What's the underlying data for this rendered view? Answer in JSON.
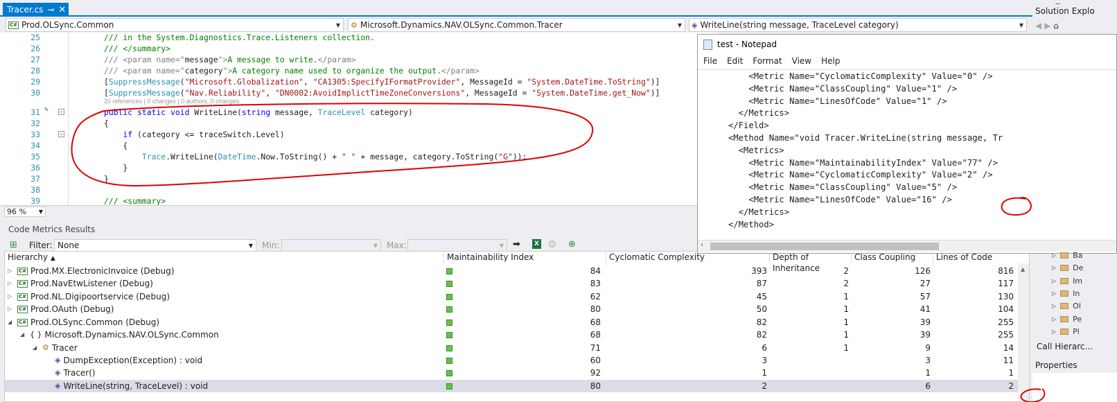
{
  "tab": {
    "title": "Tracer.cs",
    "pin": "⊸",
    "close": "✕"
  },
  "navbar": {
    "project": "Prod.OLSync.Common",
    "type": "Microsoft.Dynamics.NAV.OLSync.Common.Tracer",
    "member": "WriteLine(string message, TraceLevel category)"
  },
  "editor": {
    "lines": [
      {
        "n": "25",
        "segs": [
          {
            "t": "/// in the System.Diagnostics.Trace.Listeners collection.",
            "c": "cm"
          }
        ]
      },
      {
        "n": "26",
        "segs": [
          {
            "t": "/// </summary>",
            "c": "cm"
          }
        ]
      },
      {
        "n": "27",
        "segs": [
          {
            "t": "/// <param name=\"",
            "c": "xg"
          },
          {
            "t": "message",
            "c": ""
          },
          {
            "t": "\">",
            "c": "xg"
          },
          {
            "t": "A message to write.",
            "c": "cm"
          },
          {
            "t": "</param>",
            "c": "xg"
          }
        ]
      },
      {
        "n": "28",
        "segs": [
          {
            "t": "/// <param name=\"",
            "c": "xg"
          },
          {
            "t": "category",
            "c": ""
          },
          {
            "t": "\">",
            "c": "xg"
          },
          {
            "t": "A category name used to organize the output.",
            "c": "cm"
          },
          {
            "t": "</param>",
            "c": "xg"
          }
        ]
      },
      {
        "n": "29",
        "segs": [
          {
            "t": "[",
            "c": ""
          },
          {
            "t": "SuppressMessage",
            "c": "ty"
          },
          {
            "t": "(",
            "c": ""
          },
          {
            "t": "\"Microsoft.Globalization\"",
            "c": "st"
          },
          {
            "t": ", ",
            "c": ""
          },
          {
            "t": "\"CA1305:SpecifyIFormatProvider\"",
            "c": "st"
          },
          {
            "t": ", MessageId = ",
            "c": ""
          },
          {
            "t": "\"System.DateTime.ToString\"",
            "c": "st"
          },
          {
            "t": ")]",
            "c": ""
          }
        ]
      },
      {
        "n": "30",
        "segs": [
          {
            "t": "[",
            "c": ""
          },
          {
            "t": "SuppressMessage",
            "c": "ty"
          },
          {
            "t": "(",
            "c": ""
          },
          {
            "t": "\"Nav.Reliability\"",
            "c": "st"
          },
          {
            "t": ", ",
            "c": ""
          },
          {
            "t": "\"DN0002:AvoidImplictTimeZoneConversions\"",
            "c": "st"
          },
          {
            "t": ", MessageId = ",
            "c": ""
          },
          {
            "t": "\"System.DateTime.get_Now\"",
            "c": "st"
          },
          {
            "t": ")]",
            "c": ""
          }
        ]
      },
      {
        "n": "31",
        "segs": [
          {
            "t": "public",
            "c": "kw"
          },
          {
            "t": " ",
            "c": ""
          },
          {
            "t": "static",
            "c": "kw"
          },
          {
            "t": " ",
            "c": ""
          },
          {
            "t": "void",
            "c": "kw"
          },
          {
            "t": " WriteLine(",
            "c": ""
          },
          {
            "t": "string",
            "c": "kw"
          },
          {
            "t": " message, ",
            "c": ""
          },
          {
            "t": "TraceLevel",
            "c": "ty"
          },
          {
            "t": " category)",
            "c": ""
          }
        ]
      },
      {
        "n": "32",
        "segs": [
          {
            "t": "{",
            "c": ""
          }
        ]
      },
      {
        "n": "33",
        "segs": [
          {
            "t": "    ",
            "c": ""
          },
          {
            "t": "if",
            "c": "kw"
          },
          {
            "t": " (category <= traceSwitch.Level)",
            "c": ""
          }
        ]
      },
      {
        "n": "34",
        "segs": [
          {
            "t": "    {",
            "c": ""
          }
        ]
      },
      {
        "n": "35",
        "segs": [
          {
            "t": "        ",
            "c": ""
          },
          {
            "t": "Trace",
            "c": "ty"
          },
          {
            "t": ".WriteLine(",
            "c": ""
          },
          {
            "t": "DateTime",
            "c": "ty"
          },
          {
            "t": ".Now.ToString() + ",
            "c": ""
          },
          {
            "t": "\" \"",
            "c": "st"
          },
          {
            "t": " + message, category.ToString(",
            "c": ""
          },
          {
            "t": "\"G\"",
            "c": "st"
          },
          {
            "t": "));",
            "c": ""
          }
        ]
      },
      {
        "n": "36",
        "segs": [
          {
            "t": "    }",
            "c": ""
          }
        ]
      },
      {
        "n": "37",
        "segs": [
          {
            "t": "}",
            "c": ""
          }
        ]
      },
      {
        "n": "38",
        "segs": []
      },
      {
        "n": "39",
        "segs": [
          {
            "t": "/// <summary>",
            "c": "cm"
          }
        ]
      }
    ],
    "refs": "20 references | 0 changes | 0 authors, 0 changes",
    "zoom": "96 %"
  },
  "metrics": {
    "title": "Code Metrics Results",
    "filter_label": "Filter:",
    "filter_value": "None",
    "min_label": "Min:",
    "max_label": "Max:",
    "columns": [
      "Hierarchy",
      "Maintainability Index",
      "Cyclomatic Complexity",
      "Depth of Inheritance",
      "Class Coupling",
      "Lines of Code"
    ],
    "rows": [
      {
        "name": "Prod.MX.ElectronicInvoice (Debug)",
        "indent": 0,
        "exp": "▷",
        "icon": "cs",
        "mi": "84",
        "cc": "393",
        "di": "2",
        "cp": "126",
        "loc": "816",
        "sel": false
      },
      {
        "name": "Prod.NavEtwListener (Debug)",
        "indent": 0,
        "exp": "▷",
        "icon": "cs",
        "mi": "83",
        "cc": "87",
        "di": "2",
        "cp": "27",
        "loc": "117",
        "sel": false
      },
      {
        "name": "Prod.NL.Digipoortservice (Debug)",
        "indent": 0,
        "exp": "▷",
        "icon": "cs",
        "mi": "62",
        "cc": "45",
        "di": "1",
        "cp": "57",
        "loc": "130",
        "sel": false
      },
      {
        "name": "Prod.OAuth (Debug)",
        "indent": 0,
        "exp": "▷",
        "icon": "cs",
        "mi": "80",
        "cc": "50",
        "di": "1",
        "cp": "41",
        "loc": "104",
        "sel": false
      },
      {
        "name": "Prod.OLSync.Common (Debug)",
        "indent": 0,
        "exp": "◢",
        "icon": "cs",
        "mi": "68",
        "cc": "82",
        "di": "1",
        "cp": "39",
        "loc": "255",
        "sel": false
      },
      {
        "name": "Microsoft.Dynamics.NAV.OLSync.Common",
        "indent": 1,
        "exp": "◢",
        "icon": "ns",
        "mi": "68",
        "cc": "82",
        "di": "1",
        "cp": "39",
        "loc": "255",
        "sel": false
      },
      {
        "name": "Tracer",
        "indent": 2,
        "exp": "◢",
        "icon": "cls",
        "mi": "71",
        "cc": "6",
        "di": "1",
        "cp": "9",
        "loc": "14",
        "sel": false
      },
      {
        "name": "DumpException(Exception) : void",
        "indent": 3,
        "exp": "",
        "icon": "m",
        "mi": "60",
        "cc": "3",
        "di": "",
        "cp": "3",
        "loc": "11",
        "sel": false
      },
      {
        "name": "Tracer()",
        "indent": 3,
        "exp": "",
        "icon": "m",
        "mi": "92",
        "cc": "1",
        "di": "",
        "cp": "1",
        "loc": "1",
        "sel": false
      },
      {
        "name": "WriteLine(string, TraceLevel) : void",
        "indent": 3,
        "exp": "",
        "icon": "m",
        "mi": "80",
        "cc": "2",
        "di": "",
        "cp": "6",
        "loc": "2",
        "sel": true
      }
    ]
  },
  "notepad": {
    "title": "test - Notepad",
    "menu": [
      "File",
      "Edit",
      "Format",
      "View",
      "Help"
    ],
    "lines": [
      "          <Metric Name=\"CyclomaticComplexity\" Value=\"0\" />",
      "          <Metric Name=\"ClassCoupling\" Value=\"1\" />",
      "          <Metric Name=\"LinesOfCode\" Value=\"1\" />",
      "        </Metrics>",
      "      </Field>",
      "      <Method Name=\"void Tracer.WriteLine(string message, Tr",
      "        <Metrics>",
      "          <Metric Name=\"MaintainabilityIndex\" Value=\"77\" />",
      "          <Metric Name=\"CyclomaticComplexity\" Value=\"2\" />",
      "          <Metric Name=\"ClassCoupling\" Value=\"5\" />",
      "          <Metric Name=\"LinesOfCode\" Value=\"16\" />",
      "        </Metrics>",
      "      </Method>"
    ]
  },
  "sidebar": {
    "solution_explorer": "Solution Explo",
    "items": [
      "Ba",
      "De",
      "Im",
      "In",
      "Ol",
      "Pe",
      "Pl"
    ],
    "call_hierarchy": "Call Hierarc...",
    "properties": "Properties"
  },
  "colors": {
    "accent": "#007acc",
    "annotation": "#e00000",
    "metric_good": "#6abf4b"
  }
}
